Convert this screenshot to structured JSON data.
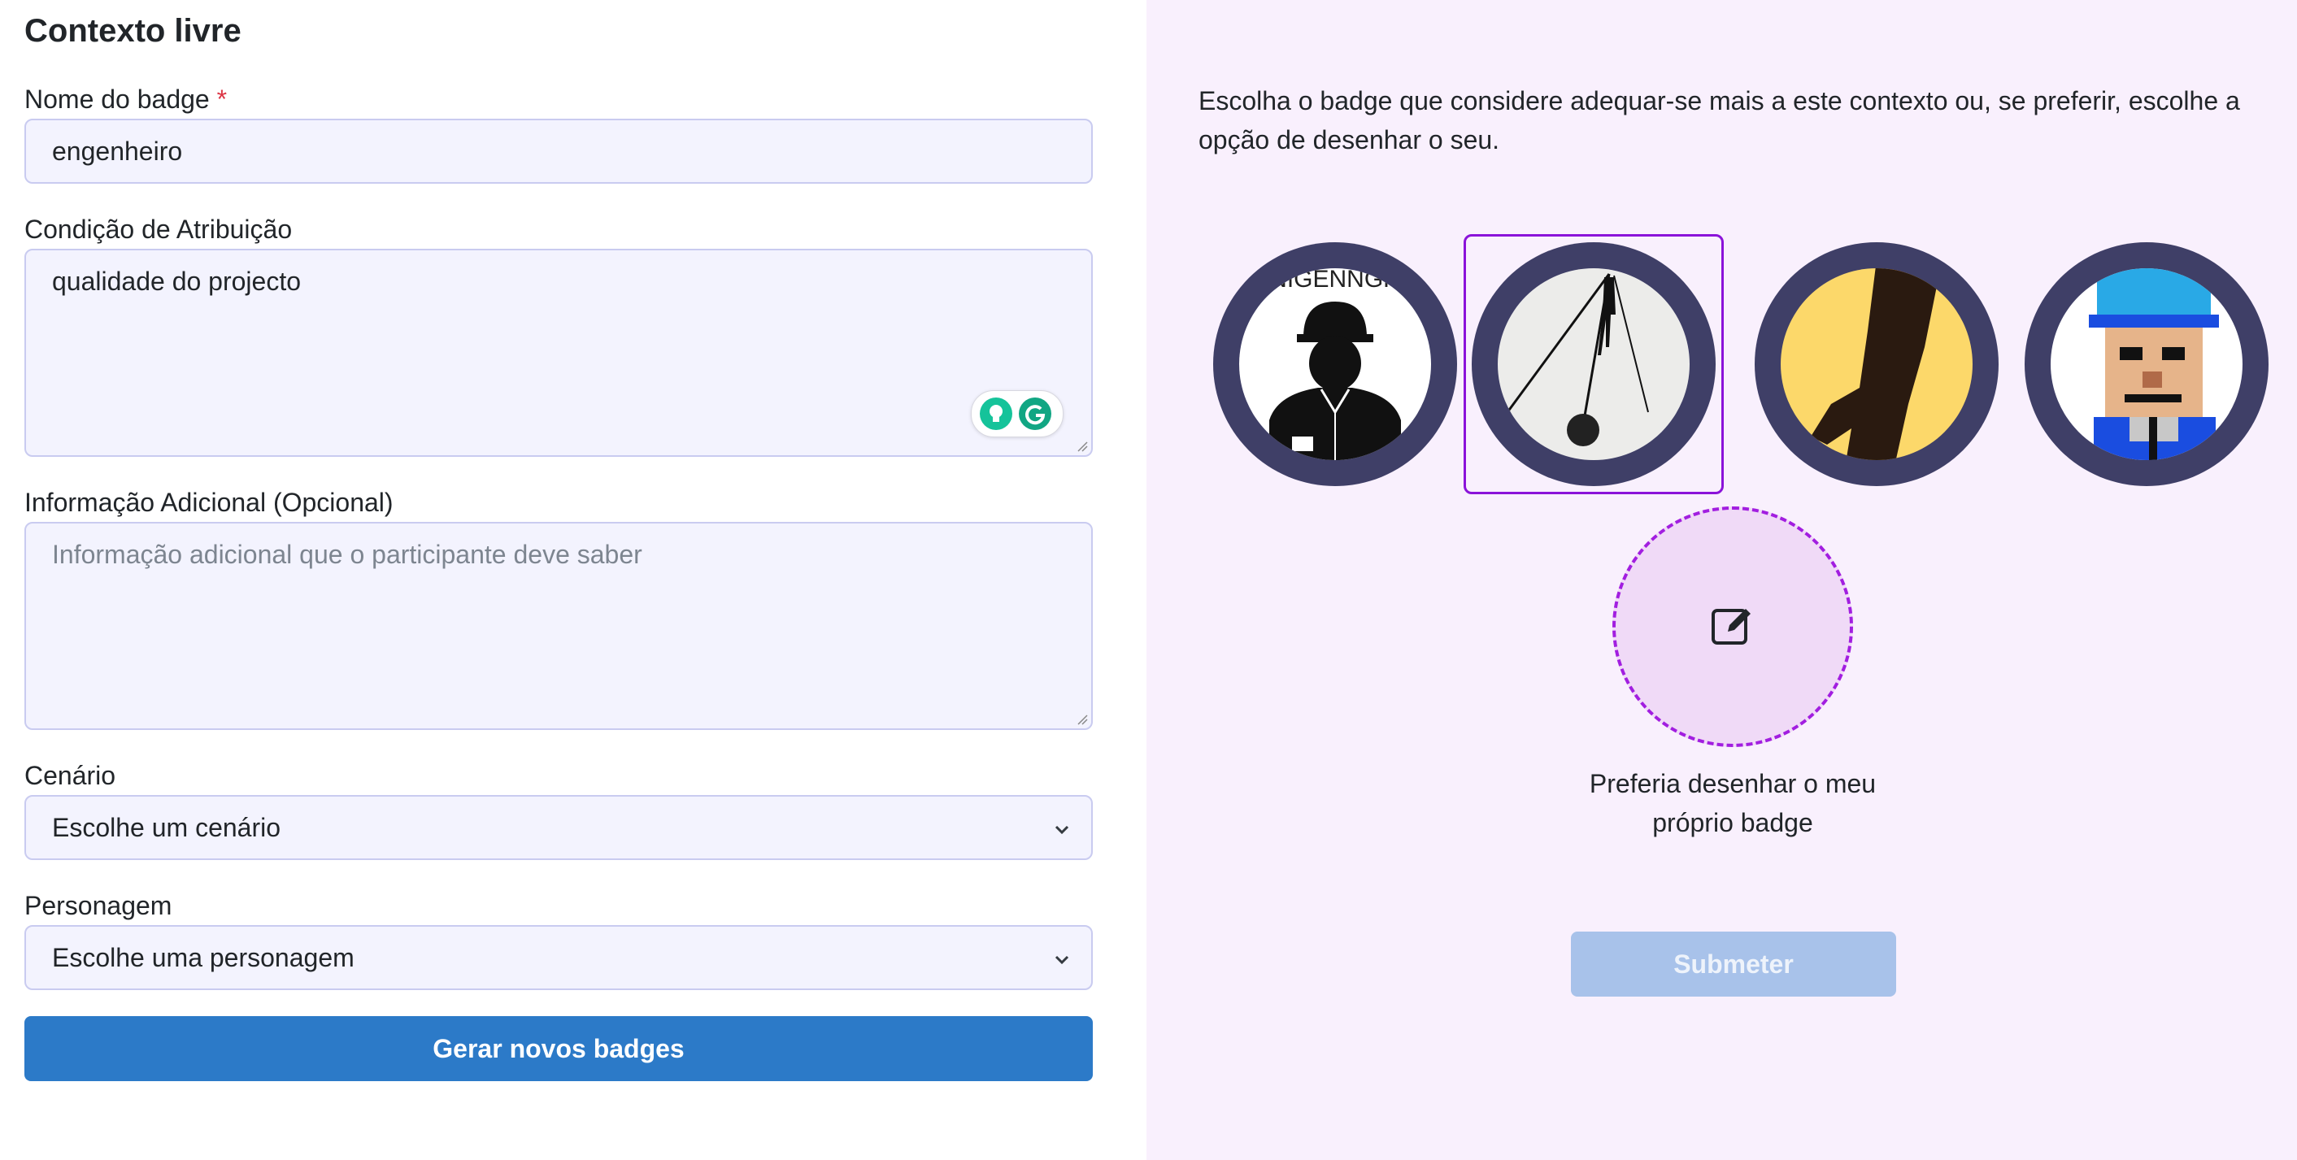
{
  "form": {
    "title": "Contexto livre",
    "badge_name": {
      "label": "Nome do badge",
      "required_mark": "*",
      "value": "engenheiro"
    },
    "condition": {
      "label": "Condição de Atribuição",
      "value": "qualidade do projecto"
    },
    "additional_info": {
      "label": "Informação Adicional (Opcional)",
      "placeholder": "Informação adicional que o participante deve saber"
    },
    "scenario": {
      "label": "Cenário",
      "selected": "Escolhe um cenário"
    },
    "character": {
      "label": "Personagem",
      "selected": "Escolhe uma personagem"
    },
    "generate_label": "Gerar novos badges"
  },
  "chooser": {
    "intro": "Escolha o badge que considere adequar-se mais a este contexto ou, se preferir, escolhe a opção de desenhar o seu.",
    "badges": [
      {
        "icon": "engineer-helmet-badge-icon",
        "text": "NIGENNGR",
        "selected": false
      },
      {
        "icon": "wrecking-ball-badge-icon",
        "selected": true
      },
      {
        "icon": "yellow-figure-badge-icon",
        "selected": false
      },
      {
        "icon": "pixel-character-badge-icon",
        "selected": false
      }
    ],
    "draw_option_label": "Preferia desenhar o meu próprio badge",
    "submit_label": "Submeter"
  },
  "colors": {
    "primary_button": "#2c7ac8",
    "selected_border": "#8b13d9",
    "right_panel_bg": "#f9f0fd",
    "badge_ring": "#3f3f67"
  }
}
